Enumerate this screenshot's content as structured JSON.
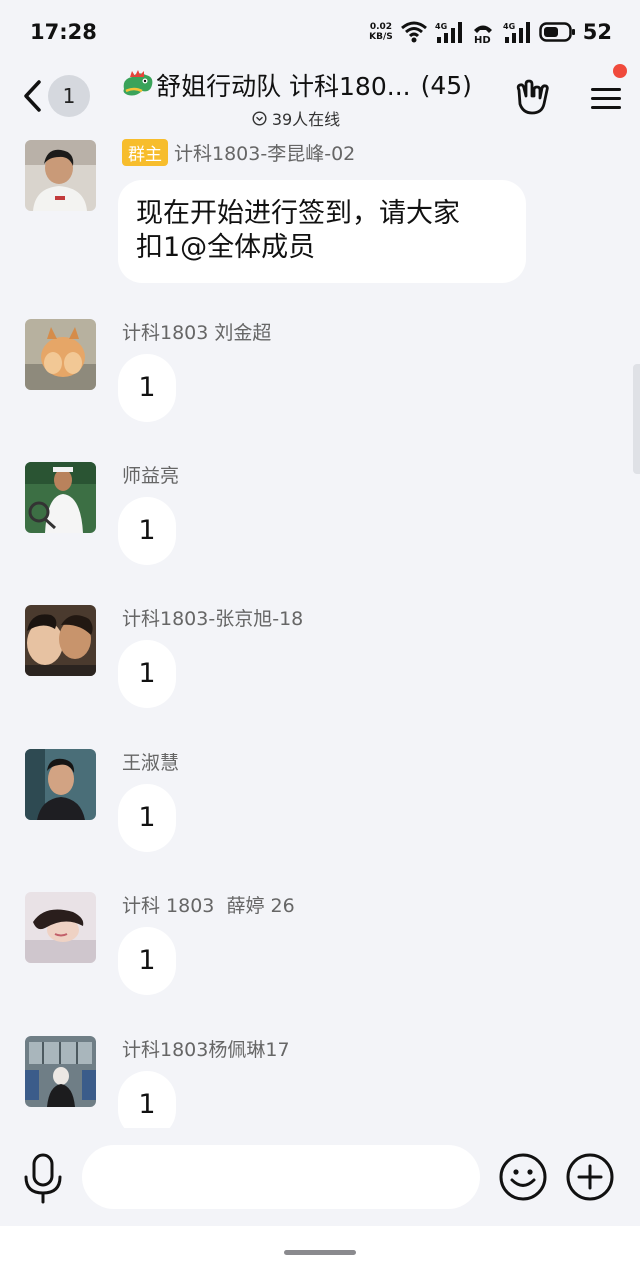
{
  "status_bar": {
    "time": "17:28",
    "net_speed_value": "0.02",
    "net_speed_unit": "KB/S",
    "signal1_label": "4G",
    "hd_label": "HD",
    "signal2_label": "4G",
    "battery": "52"
  },
  "header": {
    "back_badge": "1",
    "title": "舒姐行动队 计科180...",
    "member_count": "(45)",
    "online_status": "39人在线"
  },
  "messages": [
    {
      "role_tag": "群主",
      "sender": "计科1803-李昆峰-02",
      "text_line1": "现在开始进行签到，请大家",
      "text_line2": "扣1@全体成员"
    },
    {
      "sender": "计科1803 刘金超",
      "text": "1"
    },
    {
      "sender": "师益亮",
      "text": "1"
    },
    {
      "sender": "计科1803-张京旭-18",
      "text": "1"
    },
    {
      "sender": "王淑慧",
      "text": "1"
    },
    {
      "sender": "计科 1803  薛婷 26",
      "text": "1"
    },
    {
      "sender": "计科1803杨佩琳17",
      "text": "1"
    }
  ],
  "input": {
    "placeholder": "",
    "value": ""
  },
  "colors": {
    "background": "#f3f4f8",
    "bubble": "#ffffff",
    "role_tag": "#f7bd2c",
    "notification_dot": "#f04a3c"
  }
}
